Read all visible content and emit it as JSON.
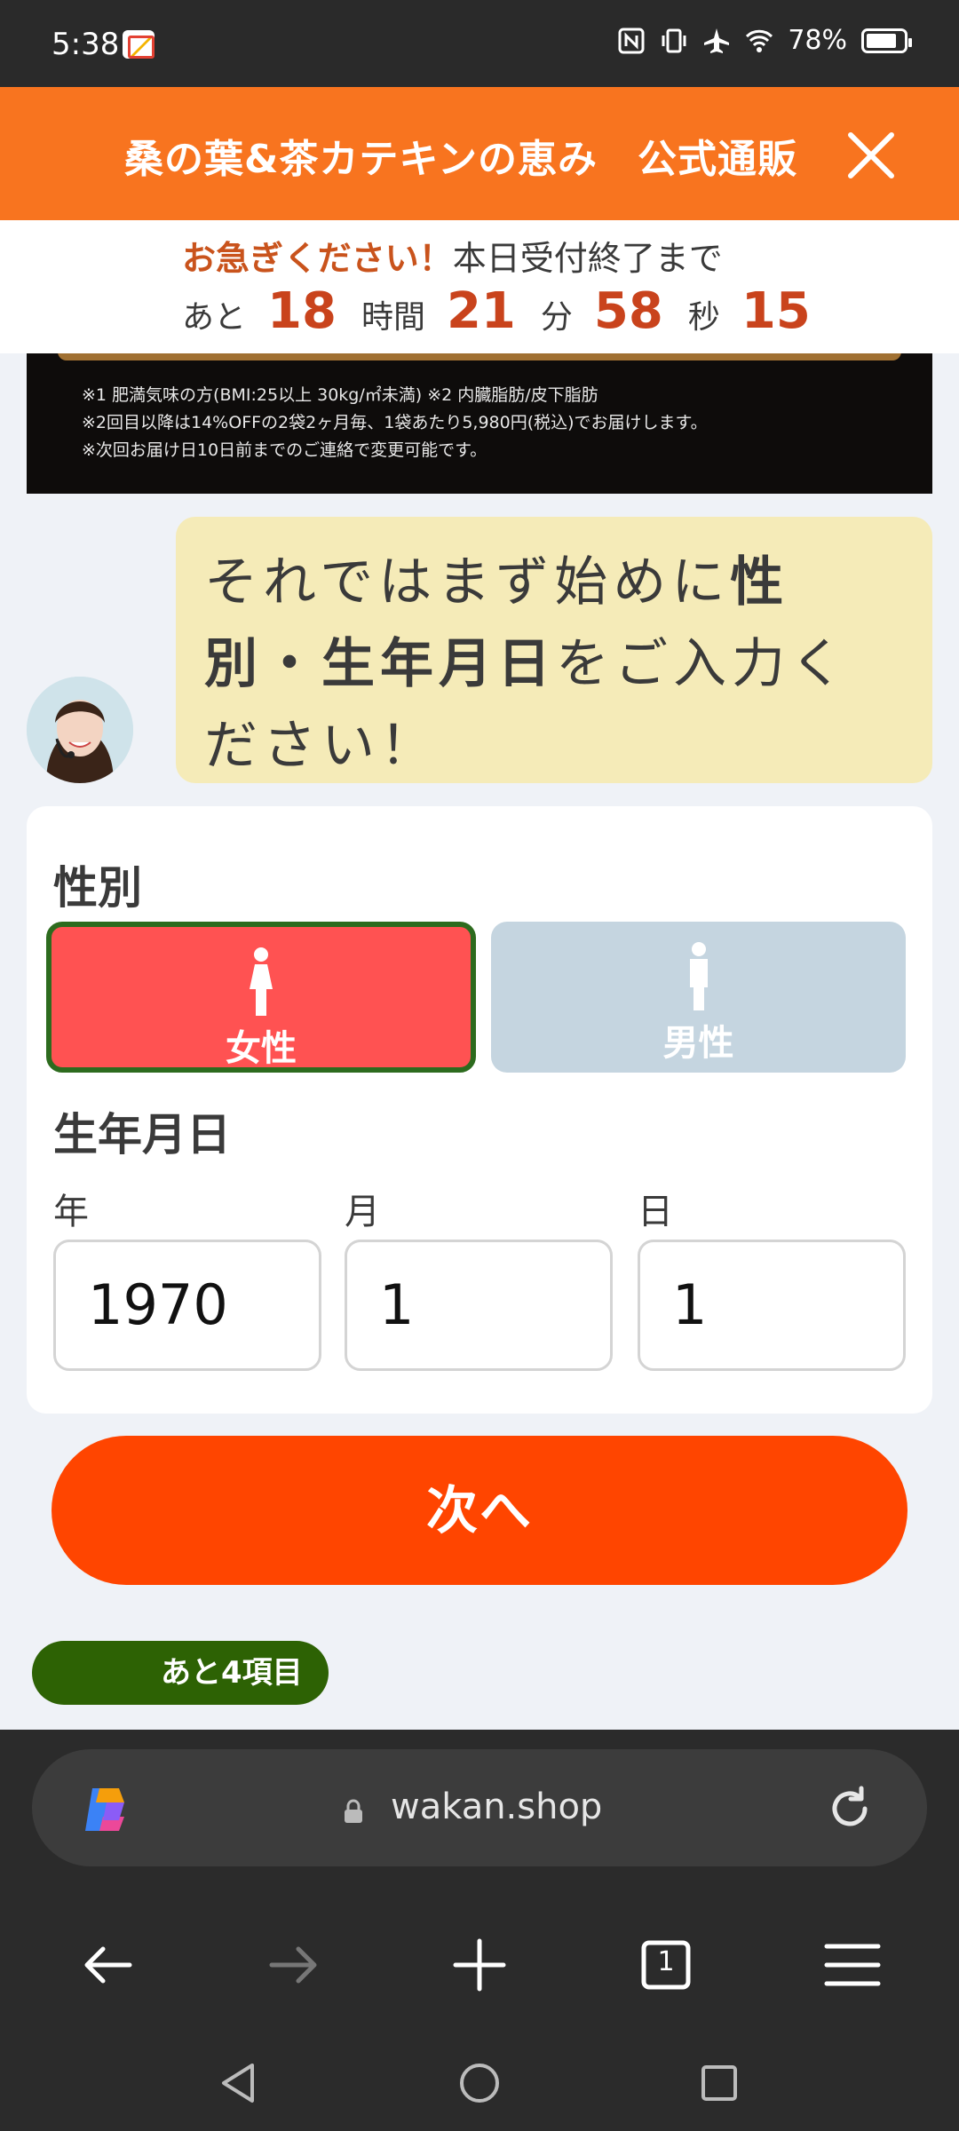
{
  "status_bar": {
    "time": "5:38",
    "battery_percent": "78%",
    "icons": [
      "gmail-icon",
      "nfc-icon",
      "vibrate-icon",
      "airplane-icon",
      "wifi-icon",
      "battery-icon"
    ]
  },
  "header": {
    "title": "桑の葉&茶カテキンの恵み　公式通販",
    "close_icon": "close-icon",
    "background": "#f8741f"
  },
  "countdown": {
    "hurry": "お急ぎください！",
    "until": "本日受付終了まで",
    "prefix": "あと",
    "hours": "18",
    "hours_label": "時間",
    "minutes": "21",
    "minutes_label": "分",
    "seconds": "58",
    "seconds_label": "秒",
    "frames": "15"
  },
  "banner": {
    "note1": "※1 肥満気味の方(BMI:25以上 30kg/㎡未満) ※2 内臓脂肪/皮下脂肪",
    "note2": "※2回目以降は14%OFFの2袋2ヶ月毎、1袋あたり5,980円(税込)でお届けします。",
    "note3": "※次回お届け日10日前までのご連絡で変更可能です。"
  },
  "chat": {
    "part1": "それではまず始めに",
    "bold1": "性別・生年月日",
    "part2": "をご入力ください！"
  },
  "form": {
    "gender_label": "性別",
    "female": "女性",
    "male": "男性",
    "selected_gender": "female",
    "birthday_label": "生年月日",
    "year_label": "年",
    "month_label": "月",
    "day_label": "日",
    "year_value": "1970",
    "month_value": "1",
    "day_value": "1"
  },
  "next_button": "次へ",
  "remaining_badge": "あと4項目",
  "browser": {
    "url": "wakan.shop",
    "tab_count": "1"
  },
  "colors": {
    "accent_orange": "#ff4500",
    "female_red": "#ff5252",
    "selected_border": "#2d6b1e",
    "badge_green": "#2d6204"
  }
}
